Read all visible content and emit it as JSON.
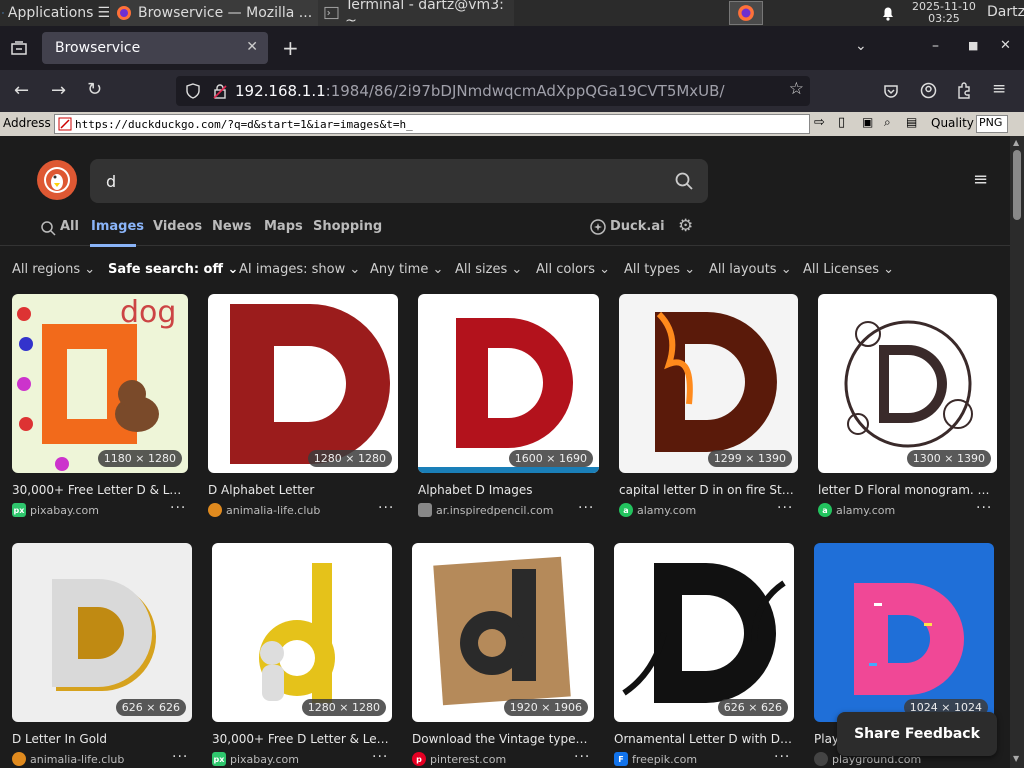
{
  "taskbar": {
    "applications": "Applications",
    "task_browser": "Browservice — Mozilla ...",
    "task_terminal": "Terminal - dartz@vm3: ~",
    "clock_date": "2025-11-10",
    "clock_time": "03:25",
    "user": "Dartz"
  },
  "browser": {
    "tab_title": "Browservice",
    "url_host": "192.168.1.1",
    "url_path": ":1984/86/2i97bDJNmdwqcmAdXppQGa19CVT5MxUB/"
  },
  "addressbar": {
    "label": "Address",
    "url": "https://duckduckgo.com/?q=d&start=1&iar=images&t=h_",
    "quality_label": "Quality",
    "format": "PNG"
  },
  "ddg": {
    "query": "d",
    "tabs": [
      "All",
      "Images",
      "Videos",
      "News",
      "Maps",
      "Shopping"
    ],
    "duck_ai": "Duck.ai",
    "filters": [
      "All regions",
      "Safe search: off",
      "AI images: show",
      "Any time",
      "All sizes",
      "All colors",
      "All types",
      "All layouts",
      "All Licenses"
    ],
    "share_feedback": "Share Feedback"
  },
  "results": [
    {
      "title": "30,000+ Free Letter D & Lett...",
      "source": "pixabay.com",
      "dims": "1180 × 1280",
      "fav": "px",
      "favcolor": "#2ec66d"
    },
    {
      "title": "D Alphabet Letter",
      "source": "animalia-life.club",
      "dims": "1280 × 1280",
      "fav": "",
      "favcolor": "#e08a1e"
    },
    {
      "title": "Alphabet D Images",
      "source": "ar.inspiredpencil.com",
      "dims": "1600 × 1690",
      "fav": "",
      "favcolor": "#888888"
    },
    {
      "title": "capital letter D in on fire Stoc...",
      "source": "alamy.com",
      "dims": "1299 × 1390",
      "fav": "a",
      "favcolor": "#22c35e"
    },
    {
      "title": "letter D Floral monogram. Vint...",
      "source": "alamy.com",
      "dims": "1300 × 1390",
      "fav": "a",
      "favcolor": "#22c35e"
    },
    {
      "title": "D Letter In Gold",
      "source": "animalia-life.club",
      "dims": "626 × 626",
      "fav": "",
      "favcolor": "#e08a1e"
    },
    {
      "title": "30,000+ Free D Letter & Lett...",
      "source": "pixabay.com",
      "dims": "1280 × 1280",
      "fav": "px",
      "favcolor": "#2ec66d"
    },
    {
      "title": "Download the Vintage typewr...",
      "source": "pinterest.com",
      "dims": "1920 × 1906",
      "fav": "p",
      "favcolor": "#e60023"
    },
    {
      "title": "Ornamental Letter D with De...",
      "source": "freepik.com",
      "dims": "626 × 626",
      "fav": "F",
      "favcolor": "#1273eb"
    },
    {
      "title": "Play",
      "source": "playground.com",
      "dims": "1024 × 1024",
      "fav": "",
      "favcolor": "#444444"
    }
  ]
}
